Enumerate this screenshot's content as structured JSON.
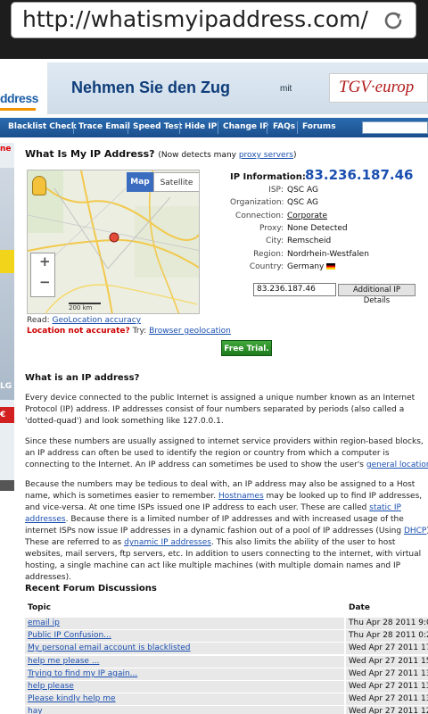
{
  "browser": {
    "url": "http://whatismyipaddress.com/"
  },
  "banner": {
    "logo_fragment": "ddress",
    "ad_text": "Nehmen Sie den Zug",
    "ad_mit": "mit",
    "ad_brand": "TGV·europ"
  },
  "nav": {
    "items": [
      "Blacklist Check",
      "Trace Email",
      "Speed Test",
      "Hide IP",
      "Change IP",
      "FAQs",
      "Forums"
    ]
  },
  "leftad": {
    "t1": "ne",
    "t2": "LG",
    "t3": "€"
  },
  "page": {
    "title": "What Is My IP Address?",
    "subtitle_pre": "(Now detects many ",
    "subtitle_link": "proxy servers",
    "subtitle_post": ")"
  },
  "map": {
    "tab_map": "Map",
    "tab_satellite": "Satellite",
    "zoom_in": "+",
    "zoom_out": "−",
    "scale": "200 km",
    "read_label": "Read: ",
    "read_link": "GeoLocation accuracy",
    "warning": "Location not accurate?",
    "try_label": " Try: ",
    "try_link": "Browser geolocation",
    "free_trial": "Free Trial."
  },
  "ip_info": {
    "label": "IP Information:",
    "ip": "83.236.187.46",
    "rows": [
      {
        "label": "ISP:",
        "value": "QSC AG"
      },
      {
        "label": "Organization:",
        "value": "QSC AG"
      },
      {
        "label": "Connection:",
        "value": "Corporate"
      },
      {
        "label": "Proxy:",
        "value": "None Detected"
      },
      {
        "label": "City:",
        "value": "Remscheid"
      },
      {
        "label": "Region:",
        "value": "Nordrhein-Westfalen"
      },
      {
        "label": "Country:",
        "value": "Germany"
      }
    ],
    "input_value": "83.236.187.46",
    "button": "Additional IP Details"
  },
  "article": {
    "heading": "What is an IP address?",
    "p1": "Every device connected to the public Internet is assigned a unique number known as an Internet Protocol (IP) address. IP addresses consist of four numbers separated by periods (also called a 'dotted-quad') and look something like 127.0.0.1.",
    "p2_pre": "Since these numbers are usually assigned to internet service providers within region-based blocks, an IP address can often be used to identify the region or country from which a computer is connecting to the Internet. An IP address can sometimes be used to show the user's ",
    "p2_link": "general location",
    "p2_post": ".",
    "p3_a": "Because the numbers may be tedious to deal with, an IP address may also be assigned to a Host name, which is sometimes easier to remember. ",
    "p3_link1": "Hostnames",
    "p3_b": " may be looked up to find IP addresses, and vice-versa. At one time ISPs issued one IP address to each user. These are called ",
    "p3_link2": "static IP addresses",
    "p3_c": ". Because there is a limited number of IP addresses and with increased usage of the internet ISPs now issue IP addresses in a dynamic fashion out of a pool of IP addresses (Using ",
    "p3_link3": "DHCP",
    "p3_d": "). These are referred to as ",
    "p3_link4": "dynamic IP addresses",
    "p3_e": ". This also limits the ability of the user to host websites, mail servers, ftp servers, etc. In addition to users connecting to the internet, with virtual hosting, a single machine can act like multiple machines (with multiple domain names and IP addresses)."
  },
  "forum": {
    "heading": "Recent Forum Discussions",
    "col_topic": "Topic",
    "col_date": "Date",
    "rows": [
      {
        "topic": "email ip",
        "date": "Thu Apr 28 2011 9:0"
      },
      {
        "topic": "Public IP Confusion...",
        "date": "Thu Apr 28 2011 0:2"
      },
      {
        "topic": "My personal email account is blacklisted",
        "date": "Wed Apr 27 2011 17"
      },
      {
        "topic": "help me please ...",
        "date": "Wed Apr 27 2011 15"
      },
      {
        "topic": "Trying to find my IP again...",
        "date": "Wed Apr 27 2011 13"
      },
      {
        "topic": "help please",
        "date": "Wed Apr 27 2011 13"
      },
      {
        "topic": "Please kindly help me",
        "date": "Wed Apr 27 2011 13"
      },
      {
        "topic": "hay",
        "date": "Wed Apr 27 2011 12"
      }
    ]
  }
}
